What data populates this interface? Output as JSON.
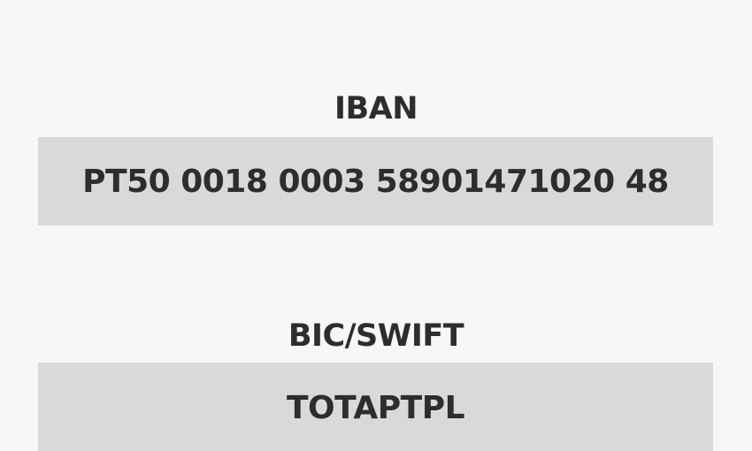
{
  "iban": {
    "label": "IBAN",
    "value": "PT50 0018 0003 58901471020 48"
  },
  "bic": {
    "label": "BIC/SWIFT",
    "value": "TOTAPTPL"
  }
}
